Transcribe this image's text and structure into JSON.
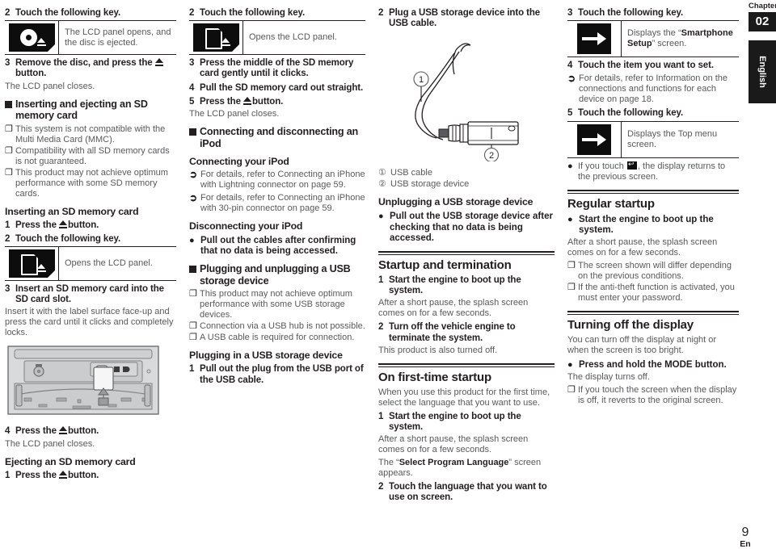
{
  "chapter": {
    "label": "Chapter",
    "number": "02"
  },
  "language_tab": "English",
  "footer": {
    "page_number": "9",
    "language_code": "En"
  },
  "column1": {
    "step2": {
      "num": "2",
      "text": "Touch the following key."
    },
    "keybox1": {
      "icon": "disc-eject-key-icon",
      "desc_line1": "The LCD panel opens, and",
      "desc_line2": "the disc is ejected."
    },
    "step3": {
      "num": "3",
      "text_a": "Remove the disc, and press the ",
      "text_b": "button."
    },
    "step3_body": "The LCD panel closes.",
    "heading_insert_eject": "Inserting and ejecting an SD memory card",
    "notes": [
      "This system is not compatible with the Multi Media Card (MMC).",
      "Compatibility with all SD memory cards is not guaranteed.",
      "This product may not achieve optimum performance with some SD memory cards."
    ],
    "heading_inserting": "Inserting an SD memory card",
    "step1": {
      "num": "1",
      "text_a": "Press the ",
      "text_b": "button."
    },
    "step2b": {
      "num": "2",
      "text": "Touch the following key."
    },
    "keybox2": {
      "icon": "sd-card-eject-key-icon",
      "desc": "Opens the LCD panel."
    },
    "step3b": {
      "num": "3",
      "text": "Insert an SD memory card into the SD card slot."
    },
    "step3b_body": "Insert it with the label surface face-up and press the card until it clicks and completely locks.",
    "illustration": "sd-card-insertion-diagram",
    "step4": {
      "num": "4",
      "text_a": "Press the ",
      "text_b": "button."
    },
    "step4_body": "The LCD panel closes.",
    "heading_ejecting": "Ejecting an SD memory card",
    "step1c": {
      "num": "1",
      "text_a": "Press the ",
      "text_b": "button."
    }
  },
  "column2": {
    "step2": {
      "num": "2",
      "text": "Touch the following key."
    },
    "keybox": {
      "icon": "sd-card-eject-key-icon",
      "desc": "Opens the LCD panel."
    },
    "step3": {
      "num": "3",
      "text_pre": "Press the middle of the ",
      "text_bold": "SD",
      "text_post": " memory card gently until it clicks."
    },
    "step4": {
      "num": "4",
      "text_pre": "Pull the ",
      "text_bold": "SD",
      "text_post": " memory card out straight."
    },
    "step5": {
      "num": "5",
      "text_a": "Press the ",
      "text_b": "button."
    },
    "step5_body": "The LCD panel closes.",
    "heading_connecting": "Connecting and disconnecting an iPod",
    "heading_connect_ipod": "Connecting your iPod",
    "refs": [
      "For details, refer to Connecting an iPhone with Lightning connector on page 59.",
      "For details, refer to Connecting an iPhone with 30-pin connector on page 59."
    ],
    "heading_disconnect_ipod": "Disconnecting your iPod",
    "bullet_disconnect": "Pull out the cables after confirming that no data is being accessed.",
    "heading_plugging": "Plugging and unplugging a USB storage device",
    "notes": [
      "This product may not achieve optimum performance with some USB storage devices.",
      "Connection via a USB hub is not possible.",
      "A USB cable is required for connection."
    ],
    "heading_plugging_in": "Plugging in a USB storage device",
    "step1": {
      "num": "1",
      "text_pre": "Pull out the plug from the ",
      "text_bold": "USB",
      "text_post": " port of the ",
      "text_bold2": "USB",
      "text_post2": " cable."
    }
  },
  "column3": {
    "step2": {
      "num": "2",
      "text_pre": "Plug a ",
      "text_bold": "USB",
      "text_mid": " storage device into the ",
      "text_bold2": "USB",
      "text_post": " cable."
    },
    "illustration": "usb-cable-storage-device-diagram",
    "legend": [
      {
        "marker": "1",
        "label": "USB cable"
      },
      {
        "marker": "2",
        "label": "USB storage device"
      }
    ],
    "heading_unplugging": "Unplugging a USB storage device",
    "bullet_unplug": "Pull out the USB storage device after checking that no data is being accessed.",
    "heading_startup": "Startup and termination",
    "step1": {
      "num": "1",
      "text": "Start the engine to boot up the system."
    },
    "step1_body": "After a short pause, the splash screen comes on for a few seconds.",
    "step2b": {
      "num": "2",
      "text": "Turn off the vehicle engine to terminate the system."
    },
    "step2b_body": "This product is also turned off.",
    "heading_firsttime": "On first-time startup",
    "firsttime_body": "When you use this product for the first time, select the language that you want to use.",
    "ft_step1": {
      "num": "1",
      "text": "Start the engine to boot up the system."
    },
    "ft_step1_body": "After a short pause, the splash screen comes on for a few seconds.",
    "ft_step1_body2_pre": "The “",
    "ft_step1_body2_bold": "Select Program Language",
    "ft_step1_body2_post": "” screen appears.",
    "ft_step2": {
      "num": "2",
      "text": "Touch the language that you want to use on screen."
    }
  },
  "column4": {
    "step3": {
      "num": "3",
      "text": "Touch the following key."
    },
    "keybox1": {
      "icon": "right-arrow-key-icon",
      "desc_pre": "Displays the “",
      "desc_bold": "Smartphone Setup",
      "desc_post": "” screen."
    },
    "step4": {
      "num": "4",
      "text": "Touch the item you want to set."
    },
    "ref4": "For details, refer to Information on the connections and functions for each device on page 18.",
    "step5": {
      "num": "5",
      "text": "Touch the following key."
    },
    "keybox2": {
      "icon": "right-arrow-key-icon",
      "desc": "Displays the Top menu screen."
    },
    "bullet_return_pre": "If you touch ",
    "bullet_return_post": ", the display returns to the previous screen.",
    "heading_regular": "Regular startup",
    "bullet_regular": "Start the engine to boot up the system.",
    "regular_body": "After a short pause, the splash screen comes on for a few seconds.",
    "notes": [
      "The screen shown will differ depending on the previous conditions.",
      "If the anti-theft function is activated, you must enter your password."
    ],
    "heading_turnoff": "Turning off the display",
    "turnoff_body": "You can turn off the display at night or when the screen is too bright.",
    "bullet_mode": "Press and hold the MODE button.",
    "mode_body": "The display turns off.",
    "mode_note": "If you touch the screen when the display is off, it reverts to the original screen."
  }
}
